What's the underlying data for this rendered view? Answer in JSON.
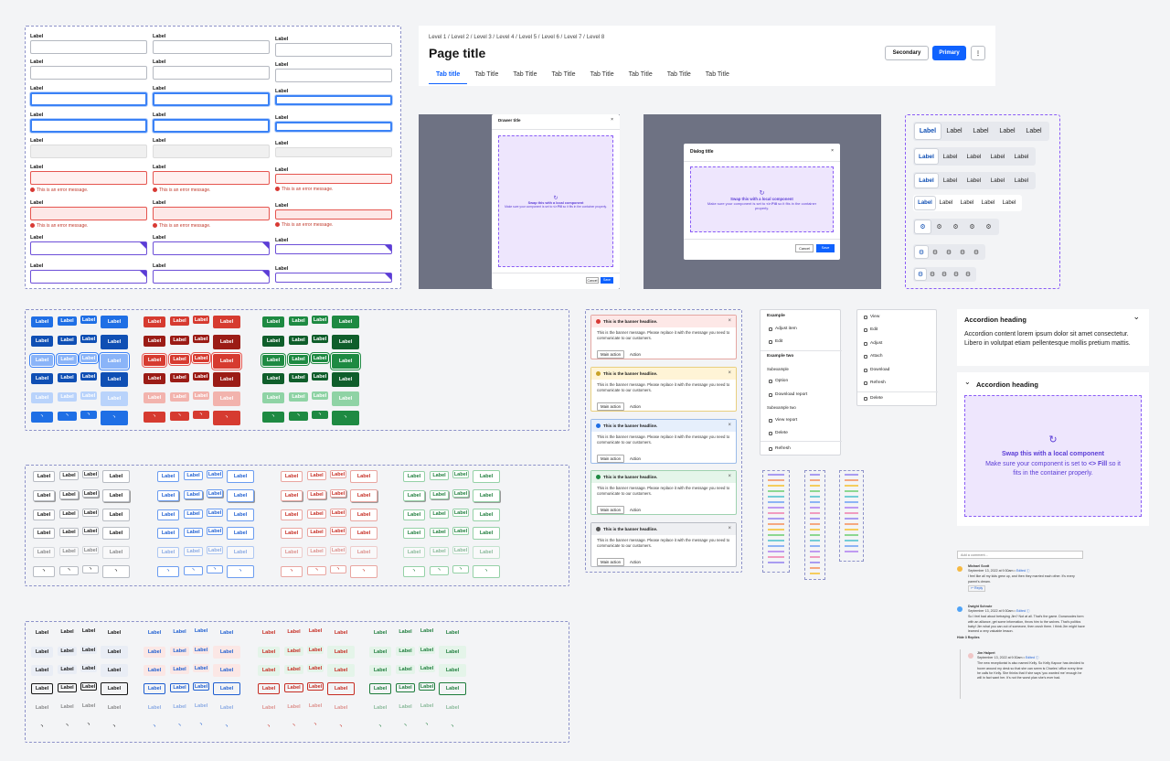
{
  "forms": {
    "label": "Label",
    "error": "This is an error message."
  },
  "header": {
    "breadcrumbs": [
      "Level 1 /",
      "Level 2 /",
      "Level 3 /",
      "Level 4 /",
      "Level 5 /",
      "Level 6 /",
      "Level 7 /",
      "Level 8"
    ],
    "title": "Page title",
    "tabs": [
      "Tab title",
      "Tab Title",
      "Tab Title",
      "Tab Title",
      "Tab Title",
      "Tab Title",
      "Tab Title",
      "Tab Title"
    ],
    "secondary": "Secondary",
    "primary": "Primary",
    "more": "⋮"
  },
  "drawer": {
    "title": "Drawer title",
    "close": "×",
    "cancel": "Cancel",
    "save": "Save"
  },
  "dialog": {
    "title": "Dialog title",
    "close": "×",
    "cancel": "Cancel",
    "save": "Save"
  },
  "swap": {
    "title": "Swap this with a local component",
    "line1": "Make sure your component is set to",
    "fill": "<> Fill",
    "line2": "so it fits in the container properly.",
    "icon": "↻"
  },
  "segmented": {
    "label": "Label"
  },
  "buttons": {
    "label": "Label",
    "spinner": "◝"
  },
  "banners": [
    {
      "headline": "This is the banner headline.",
      "message": "This is the banner message. Please replace it with the message you need to communicate to our customers.",
      "main": "Main action",
      "action": "Action",
      "close": "×"
    }
  ],
  "menu1": {
    "items": [
      "Example",
      "Adjust item",
      "Edit",
      "Example two",
      "Subexample",
      "Option",
      "Download report",
      "Subexample two",
      "View report",
      "Delete",
      "Refresh"
    ]
  },
  "menu2": {
    "items": [
      "View",
      "Edit",
      "Adjust",
      "Attach",
      "Download",
      "Refresh",
      "Delete"
    ]
  },
  "accordion": {
    "heading1": "Accordion heading",
    "content": "Accordion content lorem ipsum dolor sit amet consectetur. Libero in volutpat etiam pellentesque mollis pretium mattis.",
    "heading2": "Accordion heading",
    "chev_down": "⌄",
    "chev_right": "⌄"
  },
  "comments": {
    "placeholder": "Add a comment...",
    "c1_name": "Michael Scott",
    "c1_date": "September 13, 2022 at 9:30am •",
    "c1_edit": "Edited ⓘ",
    "c1_text": "I feel like all my kids grew up, and then they married each other. It's every parent's dream.",
    "c1_reply": "↩ Reply",
    "c2_name": "Dwight Schrute",
    "c2_date": "September 13, 2022 at 9:30am •",
    "c2_edit": "Edited ⓘ",
    "c2_text": "So I feel bad about betraying Jim? Not at all. That's the game. Dunwoodes form with an alliance, get some information, throw him to the wolves. That's politics baby! Jim what you can out of someone, then crush them. I think Jim might have learned a very valuable lesson.",
    "c2_hide": "Hide 3 Replies",
    "c3_name": "Jim Halpert",
    "c3_date": "September 13, 2022 at 9:30am •",
    "c3_edit": "Edited ⓘ",
    "c3_text": "The new receptionist is also named Kelly. So Kelly Kapoor has decided to hover around my desk so that she can seem is Charles' office every time he calls for Kelly. She thinks that if she says 'you wanted me' enough he will in fact want her. It's not the worst plan she's ever had."
  },
  "colors": {
    "blue": "#1f6fe5",
    "red": "#d63b30",
    "green": "#1e8a42",
    "purple": "#5b3dd6",
    "slab": "#6e7283"
  }
}
